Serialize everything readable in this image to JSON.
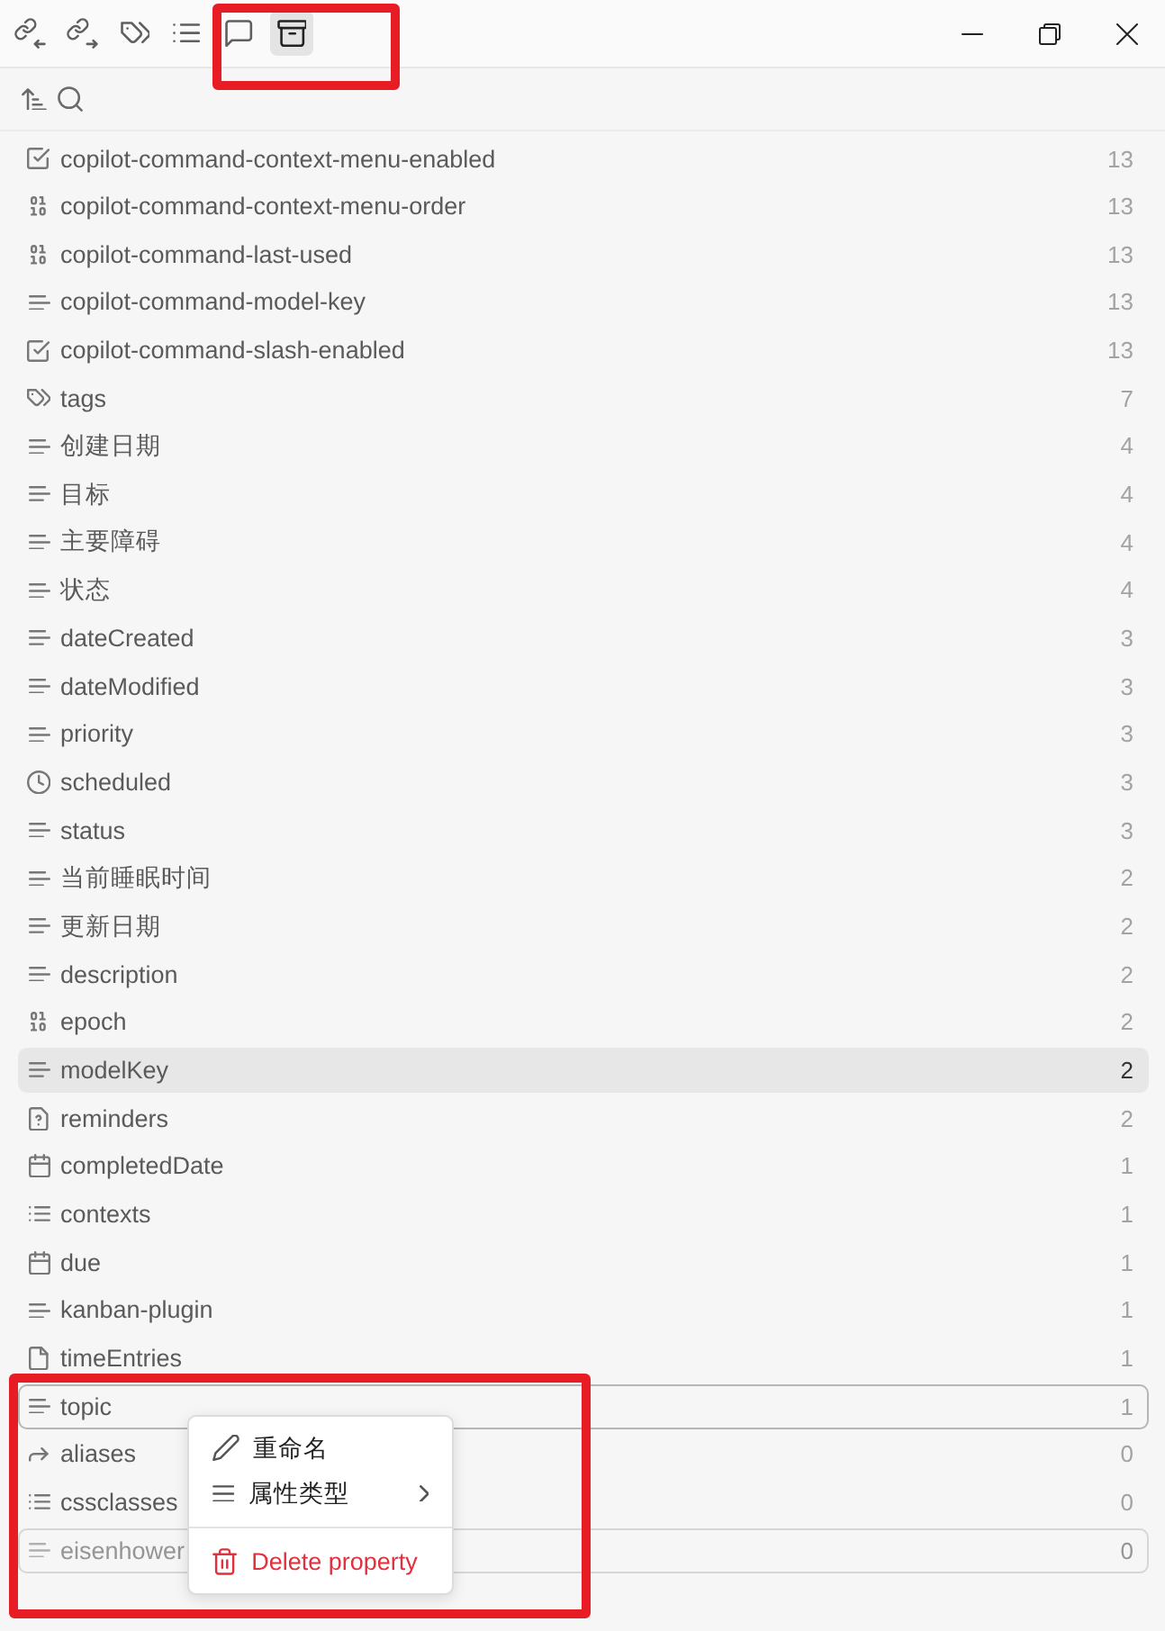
{
  "view_tabs": {
    "annotated": true,
    "items": [
      {
        "kind": "backlinks",
        "selected": false
      },
      {
        "kind": "outgoing-links",
        "selected": false
      },
      {
        "kind": "tags",
        "selected": false
      },
      {
        "kind": "outline",
        "selected": false
      },
      {
        "kind": "comments",
        "selected": false
      },
      {
        "kind": "properties",
        "selected": true
      }
    ]
  },
  "window_controls": [
    {
      "kind": "minimize"
    },
    {
      "kind": "restore"
    },
    {
      "kind": "close"
    }
  ],
  "toolbar": [
    {
      "kind": "sort"
    },
    {
      "kind": "search"
    }
  ],
  "properties": [
    {
      "kind": "checkbox",
      "name": "copilot-command-context-menu-enabled",
      "count": "13",
      "selected": false,
      "outlined": false,
      "dimmed": false
    },
    {
      "kind": "number",
      "name": "copilot-command-context-menu-order",
      "count": "13",
      "selected": false,
      "outlined": false,
      "dimmed": false
    },
    {
      "kind": "number",
      "name": "copilot-command-last-used",
      "count": "13",
      "selected": false,
      "outlined": false,
      "dimmed": false
    },
    {
      "kind": "text",
      "name": "copilot-command-model-key",
      "count": "13",
      "selected": false,
      "outlined": false,
      "dimmed": false
    },
    {
      "kind": "checkbox",
      "name": "copilot-command-slash-enabled",
      "count": "13",
      "selected": false,
      "outlined": false,
      "dimmed": false
    },
    {
      "kind": "tags",
      "name": "tags",
      "count": "7",
      "selected": false,
      "outlined": false,
      "dimmed": false
    },
    {
      "kind": "text",
      "name": "创建日期",
      "count": "4",
      "selected": false,
      "outlined": false,
      "dimmed": false
    },
    {
      "kind": "text",
      "name": "目标",
      "count": "4",
      "selected": false,
      "outlined": false,
      "dimmed": false
    },
    {
      "kind": "text",
      "name": "主要障碍",
      "count": "4",
      "selected": false,
      "outlined": false,
      "dimmed": false
    },
    {
      "kind": "text",
      "name": "状态",
      "count": "4",
      "selected": false,
      "outlined": false,
      "dimmed": false
    },
    {
      "kind": "text",
      "name": "dateCreated",
      "count": "3",
      "selected": false,
      "outlined": false,
      "dimmed": false
    },
    {
      "kind": "text",
      "name": "dateModified",
      "count": "3",
      "selected": false,
      "outlined": false,
      "dimmed": false
    },
    {
      "kind": "text",
      "name": "priority",
      "count": "3",
      "selected": false,
      "outlined": false,
      "dimmed": false
    },
    {
      "kind": "datetime",
      "name": "scheduled",
      "count": "3",
      "selected": false,
      "outlined": false,
      "dimmed": false
    },
    {
      "kind": "text",
      "name": "status",
      "count": "3",
      "selected": false,
      "outlined": false,
      "dimmed": false
    },
    {
      "kind": "text",
      "name": "当前睡眠时间",
      "count": "2",
      "selected": false,
      "outlined": false,
      "dimmed": false
    },
    {
      "kind": "text",
      "name": "更新日期",
      "count": "2",
      "selected": false,
      "outlined": false,
      "dimmed": false
    },
    {
      "kind": "text",
      "name": "description",
      "count": "2",
      "selected": false,
      "outlined": false,
      "dimmed": false
    },
    {
      "kind": "number",
      "name": "epoch",
      "count": "2",
      "selected": false,
      "outlined": false,
      "dimmed": false
    },
    {
      "kind": "text",
      "name": "modelKey",
      "count": "2",
      "selected": true,
      "outlined": false,
      "dimmed": false
    },
    {
      "kind": "unknown",
      "name": "reminders",
      "count": "2",
      "selected": false,
      "outlined": false,
      "dimmed": false
    },
    {
      "kind": "date",
      "name": "completedDate",
      "count": "1",
      "selected": false,
      "outlined": false,
      "dimmed": false
    },
    {
      "kind": "multitext",
      "name": "contexts",
      "count": "1",
      "selected": false,
      "outlined": false,
      "dimmed": false
    },
    {
      "kind": "date",
      "name": "due",
      "count": "1",
      "selected": false,
      "outlined": false,
      "dimmed": false
    },
    {
      "kind": "text",
      "name": "kanban-plugin",
      "count": "1",
      "selected": false,
      "outlined": false,
      "dimmed": false
    },
    {
      "kind": "file",
      "name": "timeEntries",
      "count": "1",
      "selected": false,
      "outlined": false,
      "dimmed": false
    },
    {
      "kind": "text",
      "name": "topic",
      "count": "1",
      "selected": false,
      "outlined": true,
      "dimmed": false
    },
    {
      "kind": "aliases",
      "name": "aliases",
      "count": "0",
      "selected": false,
      "outlined": false,
      "dimmed": false
    },
    {
      "kind": "multitext",
      "name": "cssclasses",
      "count": "0",
      "selected": false,
      "outlined": false,
      "dimmed": false
    },
    {
      "kind": "text",
      "name": "eisenhower",
      "count": "0",
      "selected": false,
      "outlined": true,
      "dimmed": true
    }
  ],
  "context_menu": {
    "annotated": true,
    "items": [
      {
        "kind": "rename",
        "label": "重命名",
        "submenu": false
      },
      {
        "kind": "type",
        "label": "属性类型",
        "submenu": true
      },
      {
        "kind": "separator"
      },
      {
        "kind": "delete",
        "label": "Delete property",
        "submenu": false
      }
    ]
  }
}
